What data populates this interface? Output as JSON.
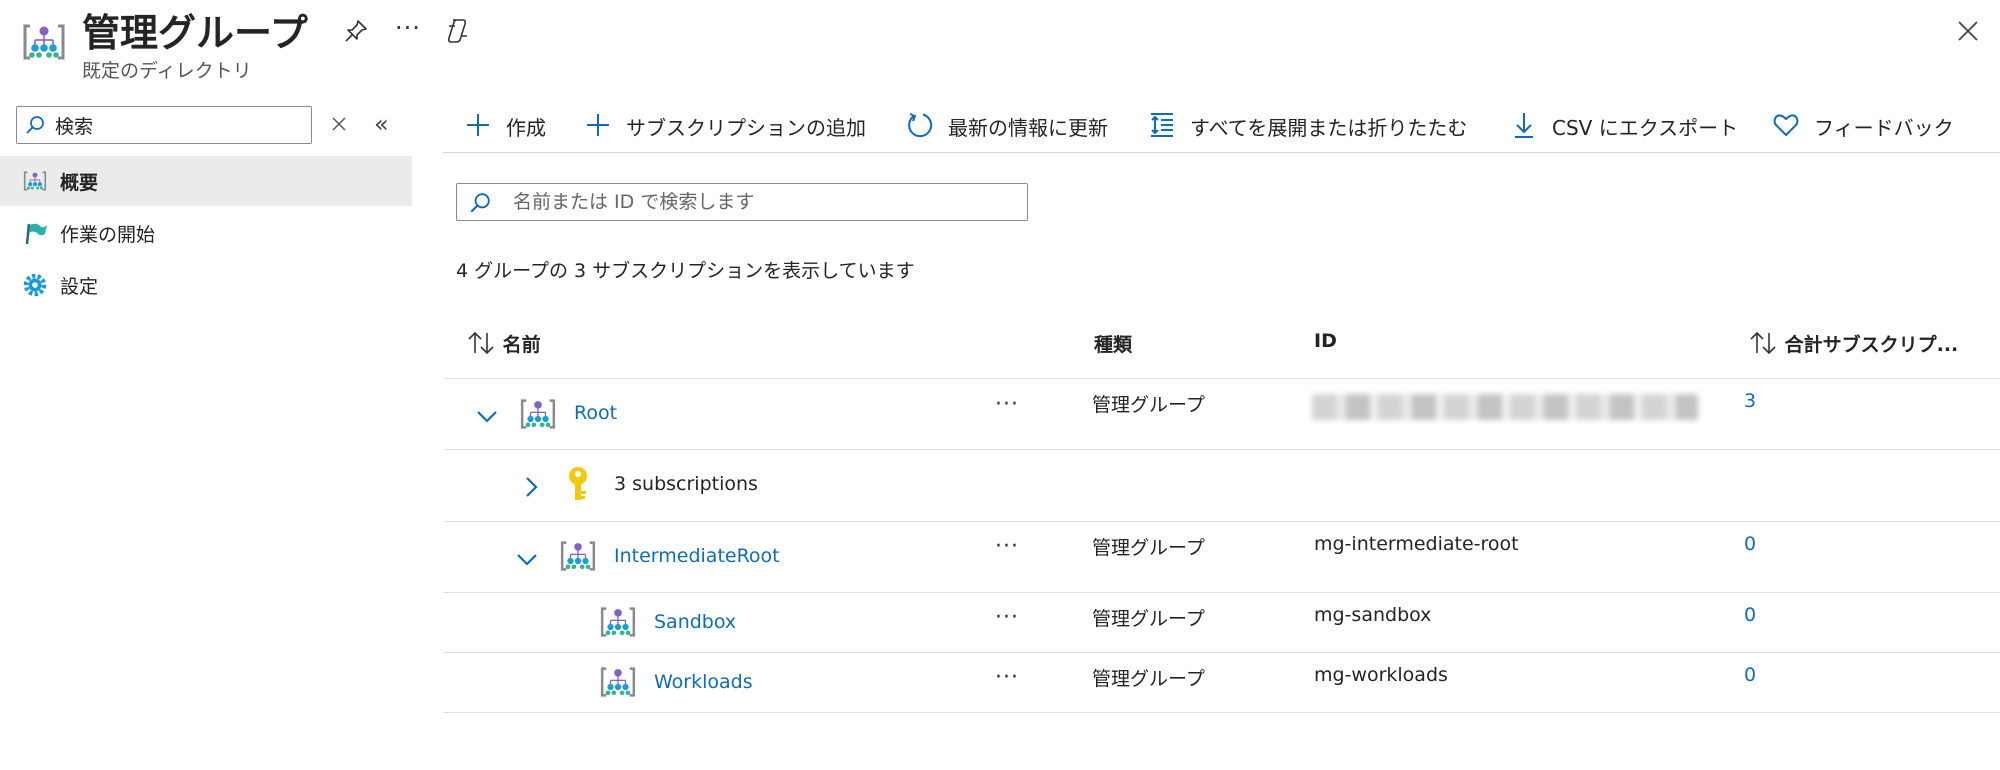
{
  "header": {
    "title": "管理グループ",
    "subtitle": "既定のディレクトリ",
    "more": "···"
  },
  "sidebar": {
    "search_value": "検索",
    "items": [
      {
        "label": "概要",
        "icon": "management-group-icon",
        "active": true
      },
      {
        "label": "作業の開始",
        "icon": "quickstart-flag-icon",
        "active": false
      },
      {
        "label": "設定",
        "icon": "settings-gear-icon",
        "active": false
      }
    ]
  },
  "toolbar": {
    "create": "作成",
    "add_subscription": "サブスクリプションの追加",
    "refresh": "最新の情報に更新",
    "expand_collapse": "すべてを展開または折りたたむ",
    "export_csv": "CSV にエクスポート",
    "feedback": "フィードバック"
  },
  "filter": {
    "placeholder": "名前または ID で検索します"
  },
  "summary": "4 グループの 3 サブスクリプションを表示しています",
  "grid": {
    "columns": {
      "name": "名前",
      "type": "種類",
      "id": "ID",
      "total": "合計サブスクリプ..."
    },
    "rows": [
      {
        "name": "Root",
        "type": "管理グループ",
        "id": "",
        "total": "3",
        "expanded": true
      },
      {
        "name": "3 subscriptions",
        "expanded": false
      },
      {
        "name": "IntermediateRoot",
        "type": "管理グループ",
        "id": "mg-intermediate-root",
        "total": "0",
        "expanded": true
      },
      {
        "name": "Sandbox",
        "type": "管理グループ",
        "id": "mg-sandbox",
        "total": "0"
      },
      {
        "name": "Workloads",
        "type": "管理グループ",
        "id": "mg-workloads",
        "total": "0"
      }
    ],
    "more": "···"
  },
  "colors": {
    "link": "#0f6cbd",
    "accent": "#0f6cbd",
    "active_nav_bg": "#ebebeb"
  }
}
